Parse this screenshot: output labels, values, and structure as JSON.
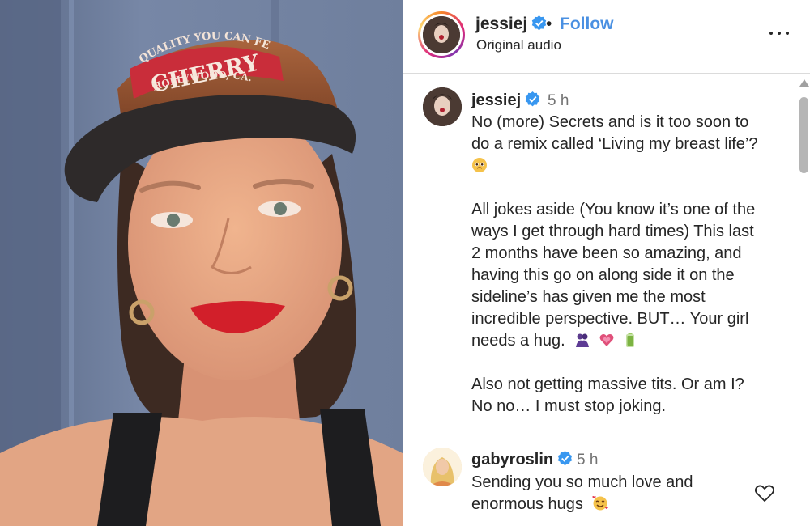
{
  "media": {
    "cap_top_text": "QUALITY YOU CAN FEEL",
    "cap_main_text": "CHERRY",
    "cap_bottom_text": "HOLLYWOOD, CA."
  },
  "header": {
    "username": "jessiej",
    "separator": "•",
    "follow_label": "Follow",
    "audio_label": "Original audio",
    "more_icon": "more-horizontal-icon"
  },
  "comments": [
    {
      "username": "jessiej",
      "time": "5 h",
      "lines": [
        "No (more) Secrets and is it too soon to",
        "do a remix called ‘Living my breast life’?",
        "",
        "",
        "All jokes aside (You know it’s one of the",
        "ways I get through hard times) This last",
        "2 months have been so amazing, and",
        "having this go on along side it on the",
        "sideline’s has given me the most",
        "incredible perspective. BUT… Your girl",
        "needs a hug.",
        "",
        "Also not getting massive tits. Or am I?",
        "No no… I must stop joking."
      ]
    },
    {
      "username": "gabyroslin",
      "time": "5 h",
      "lines": [
        "Sending you so much love and",
        "enormous hugs"
      ]
    }
  ],
  "colors": {
    "follow": "#4a90e2",
    "verified": "#3897f0",
    "text": "#262626",
    "muted": "#737373"
  }
}
